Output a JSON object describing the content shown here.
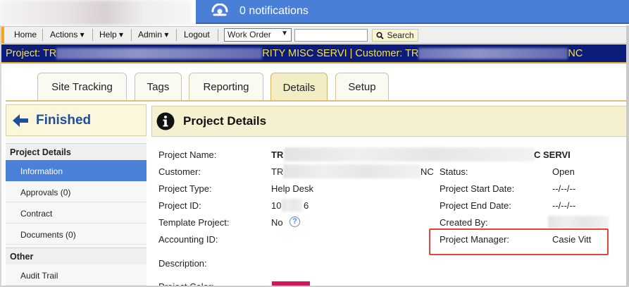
{
  "notifications": {
    "label": "0 notifications",
    "icon": "bell-hand-icon"
  },
  "nav": {
    "items": [
      "Home",
      "Actions ▾",
      "Help ▾",
      "Admin ▾",
      "Logout"
    ],
    "search_scope": "Work Order",
    "search_value": "",
    "search_button": "Search"
  },
  "banner": {
    "prefix": "Project: TR",
    "project_tail": "RITY MISC SERVI",
    "separator": " | ",
    "customer_prefix": "Customer: TR",
    "customer_tail": "NC"
  },
  "tabs": [
    {
      "label": "Site Tracking",
      "active": false
    },
    {
      "label": "Tags",
      "active": false
    },
    {
      "label": "Reporting",
      "active": false
    },
    {
      "label": "Details",
      "active": true
    },
    {
      "label": "Setup",
      "active": false
    }
  ],
  "sidebar": {
    "finished_label": "Finished",
    "sections": [
      {
        "title": "Project Details",
        "items": [
          "Information",
          "Approvals (0)",
          "Contract",
          "Documents (0)"
        ]
      },
      {
        "title": "Other",
        "items": [
          "Audit Trail"
        ]
      }
    ],
    "active_item": "Information"
  },
  "main": {
    "title": "Project Details",
    "fields": {
      "project_name_label": "Project Name:",
      "project_name_prefix": "TR",
      "project_name_suffix": "C SERVI",
      "customer_label": "Customer:",
      "customer_prefix": "TR",
      "customer_suffix": "NC",
      "project_type_label": "Project Type:",
      "project_type_value": "Help Desk",
      "project_id_label": "Project ID:",
      "project_id_prefix": "10",
      "project_id_suffix": "6",
      "template_label": "Template Project:",
      "template_value": "No",
      "accounting_label": "Accounting ID:",
      "description_label": "Description:",
      "status_label": "Status:",
      "status_value": "Open",
      "start_label": "Project Start Date:",
      "start_value": "--/--/--",
      "end_label": "Project End Date:",
      "end_value": "--/--/--",
      "created_label": "Created By:",
      "pm_label": "Project Manager:",
      "pm_value": "Casie Vitt",
      "cut_label": "Project Color:"
    },
    "help_glyph": "?"
  },
  "colors": {
    "notif_blue": "#4a7fd8",
    "banner_navy": "#0c1c7a",
    "banner_text": "#f5e04a",
    "active_blue": "#4b80d8",
    "highlight_red": "#e0473c",
    "project_color": "#d0155b"
  }
}
